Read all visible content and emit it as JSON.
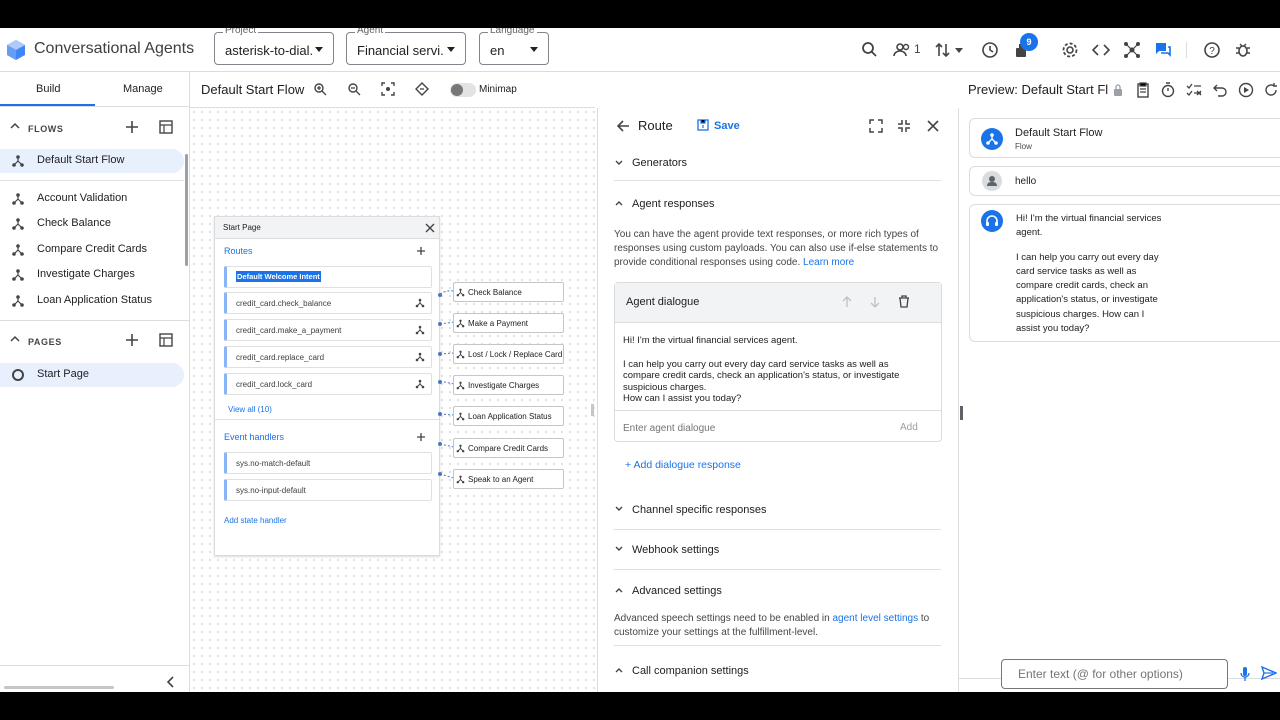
{
  "app": {
    "title": "Conversational Agents"
  },
  "topbar": {
    "project": {
      "label": "Project",
      "value": "asterisk-to-dial..."
    },
    "agent": {
      "label": "Agent",
      "value": "Financial servi..."
    },
    "language": {
      "label": "Language",
      "value": "en"
    },
    "users_count": "1",
    "notifications_badge": "9"
  },
  "sidebar": {
    "tabs": [
      "Build",
      "Manage"
    ],
    "flows_label": "FLOWS",
    "flows": [
      "Default Start Flow",
      "Account Validation",
      "Check Balance",
      "Compare Credit Cards",
      "Investigate Charges",
      "Loan Application Status"
    ],
    "pages_label": "PAGES",
    "pages": [
      "Start Page"
    ]
  },
  "canvas": {
    "flow_name": "Default Start Flow",
    "minimap_label": "Minimap",
    "start_page": {
      "title": "Start Page",
      "routes_label": "Routes",
      "routes": [
        "Default Welcome Intent",
        "credit_card.check_balance",
        "credit_card.make_a_payment",
        "credit_card.replace_card",
        "credit_card.lock_card"
      ],
      "view_all": "View all (10)",
      "event_handlers_label": "Event handlers",
      "event_handlers": [
        "sys.no-match-default",
        "sys.no-input-default"
      ],
      "add_state_handler": "Add state handler"
    },
    "target_nodes": [
      "Check Balance",
      "Make a Payment",
      "Lost / Lock / Replace Card",
      "Investigate Charges",
      "Loan Application Status",
      "Compare Credit Cards",
      "Speak to an Agent"
    ]
  },
  "route_panel": {
    "title": "Route",
    "save_label": "Save",
    "generators": "Generators",
    "agent_responses": "Agent responses",
    "agent_responses_desc": "You can have the agent provide text responses, or more rich types of responses using custom payloads. You can also use if-else statements to provide conditional responses using code.",
    "learn_more": "Learn more",
    "dialogue_title": "Agent dialogue",
    "dialogue_text_1": "Hi! I'm the virtual financial services agent.",
    "dialogue_text_2": "I can help you carry out every day card service tasks as well as compare credit cards, check an application's status, or investigate suspicious charges.",
    "dialogue_text_3": "How can I assist you today?",
    "dialogue_placeholder": "Enter agent dialogue",
    "add_label": "Add",
    "add_dialogue_response": "+ Add dialogue response",
    "channel_specific": "Channel specific responses",
    "webhook_settings": "Webhook settings",
    "advanced_settings": "Advanced settings",
    "advanced_desc_1": "Advanced speech settings need to be enabled in",
    "advanced_link": "agent level settings",
    "advanced_desc_2": "to customize your settings at the fulfillment-level.",
    "call_companion": "Call companion settings"
  },
  "preview": {
    "title": "Preview: Default Start Fl",
    "flow_name": "Default Start Flow",
    "flow_type": "Flow",
    "user_message": "hello",
    "agent_message_1": "Hi! I'm the virtual financial services agent.",
    "agent_message_2": "I can help you carry out every day card service tasks as well as compare credit cards, check an application's status, or investigate suspicious charges. How can I assist you today?",
    "input_placeholder": "Enter text (@ for other options)"
  },
  "colors": {
    "accent": "#1a73e8",
    "selected_bg": "#e8f0fe",
    "route_border": "#8ab4f8"
  }
}
